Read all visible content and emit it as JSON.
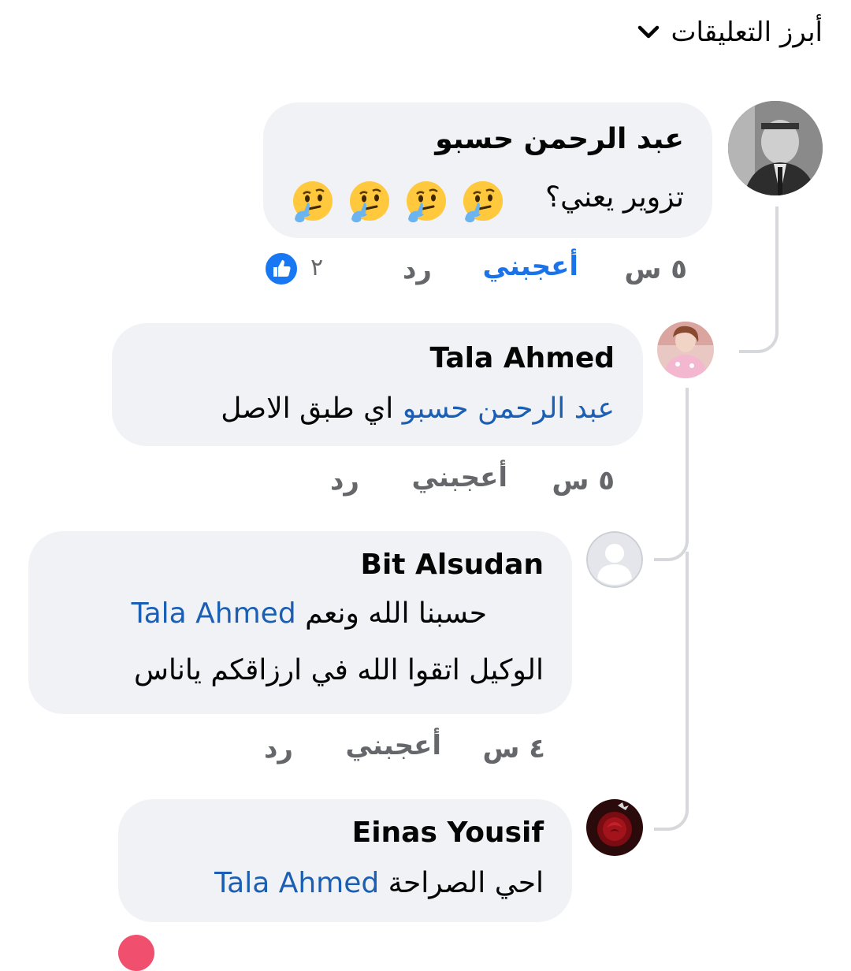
{
  "header": {
    "sort_label": "أبرز التعليقات"
  },
  "comments": [
    {
      "author": "عبد الرحمن حسبو",
      "text": "تزوير يعني؟",
      "emojis": [
        "thinking-face",
        "thinking-face",
        "thinking-face",
        "thinking-face"
      ],
      "time": "٥ س",
      "like_label": "أعجبني",
      "reply_label": "رد",
      "reaction_count": "٢",
      "liked": true
    },
    {
      "author": "Tala Ahmed",
      "mention": "عبد الرحمن حسبو",
      "text": "اي طبق الاصل",
      "time": "٥ س",
      "like_label": "أعجبني",
      "reply_label": "رد"
    },
    {
      "author": "Bit Alsudan",
      "mention": "Tala Ahmed",
      "text_line1": "حسبنا الله ونعم",
      "text_line2": "الوكيل اتقوا الله في ارزاقكم ياناس",
      "time": "٤ س",
      "like_label": "أعجبني",
      "reply_label": "رد"
    },
    {
      "author": "Einas Yousif",
      "mention": "Tala Ahmed",
      "text": "احي الصراحة"
    }
  ],
  "colors": {
    "bubble": "#f0f2f5",
    "mention": "#1b5fb5",
    "like_active": "#1a73e8",
    "meta": "#65676b",
    "thread_line": "#d6d8dc"
  }
}
